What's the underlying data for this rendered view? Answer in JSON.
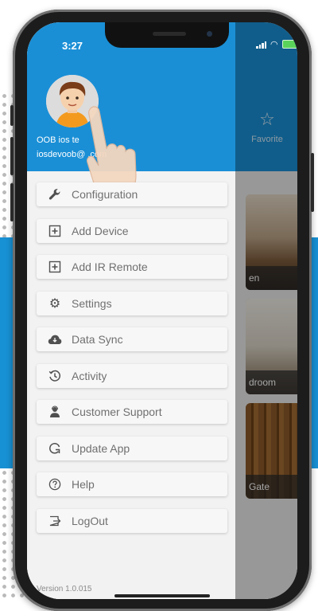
{
  "status_bar": {
    "time": "3:27"
  },
  "profile": {
    "name": "OOB ios te",
    "email": "iosdevoob@     .com"
  },
  "menu": [
    {
      "icon": "wrench-icon",
      "label": "Configuration"
    },
    {
      "icon": "add-box-icon",
      "label": "Add Device"
    },
    {
      "icon": "add-box-icon",
      "label": "Add IR Remote"
    },
    {
      "icon": "gear-icon",
      "label": "Settings"
    },
    {
      "icon": "cloud-sync-icon",
      "label": "Data Sync"
    },
    {
      "icon": "history-icon",
      "label": "Activity"
    },
    {
      "icon": "support-icon",
      "label": "Customer Support"
    },
    {
      "icon": "refresh-icon",
      "label": "Update App"
    },
    {
      "icon": "help-icon",
      "label": "Help"
    },
    {
      "icon": "logout-icon",
      "label": "LogOut"
    }
  ],
  "version": "Version  1.0.015",
  "background_app": {
    "favorite_label": "Favorite",
    "rooms": [
      "en",
      "droom",
      "Gate"
    ]
  },
  "colors": {
    "accent": "#1a8fd6",
    "drawer_bg": "#f2f2f2",
    "menu_text": "#707070"
  }
}
